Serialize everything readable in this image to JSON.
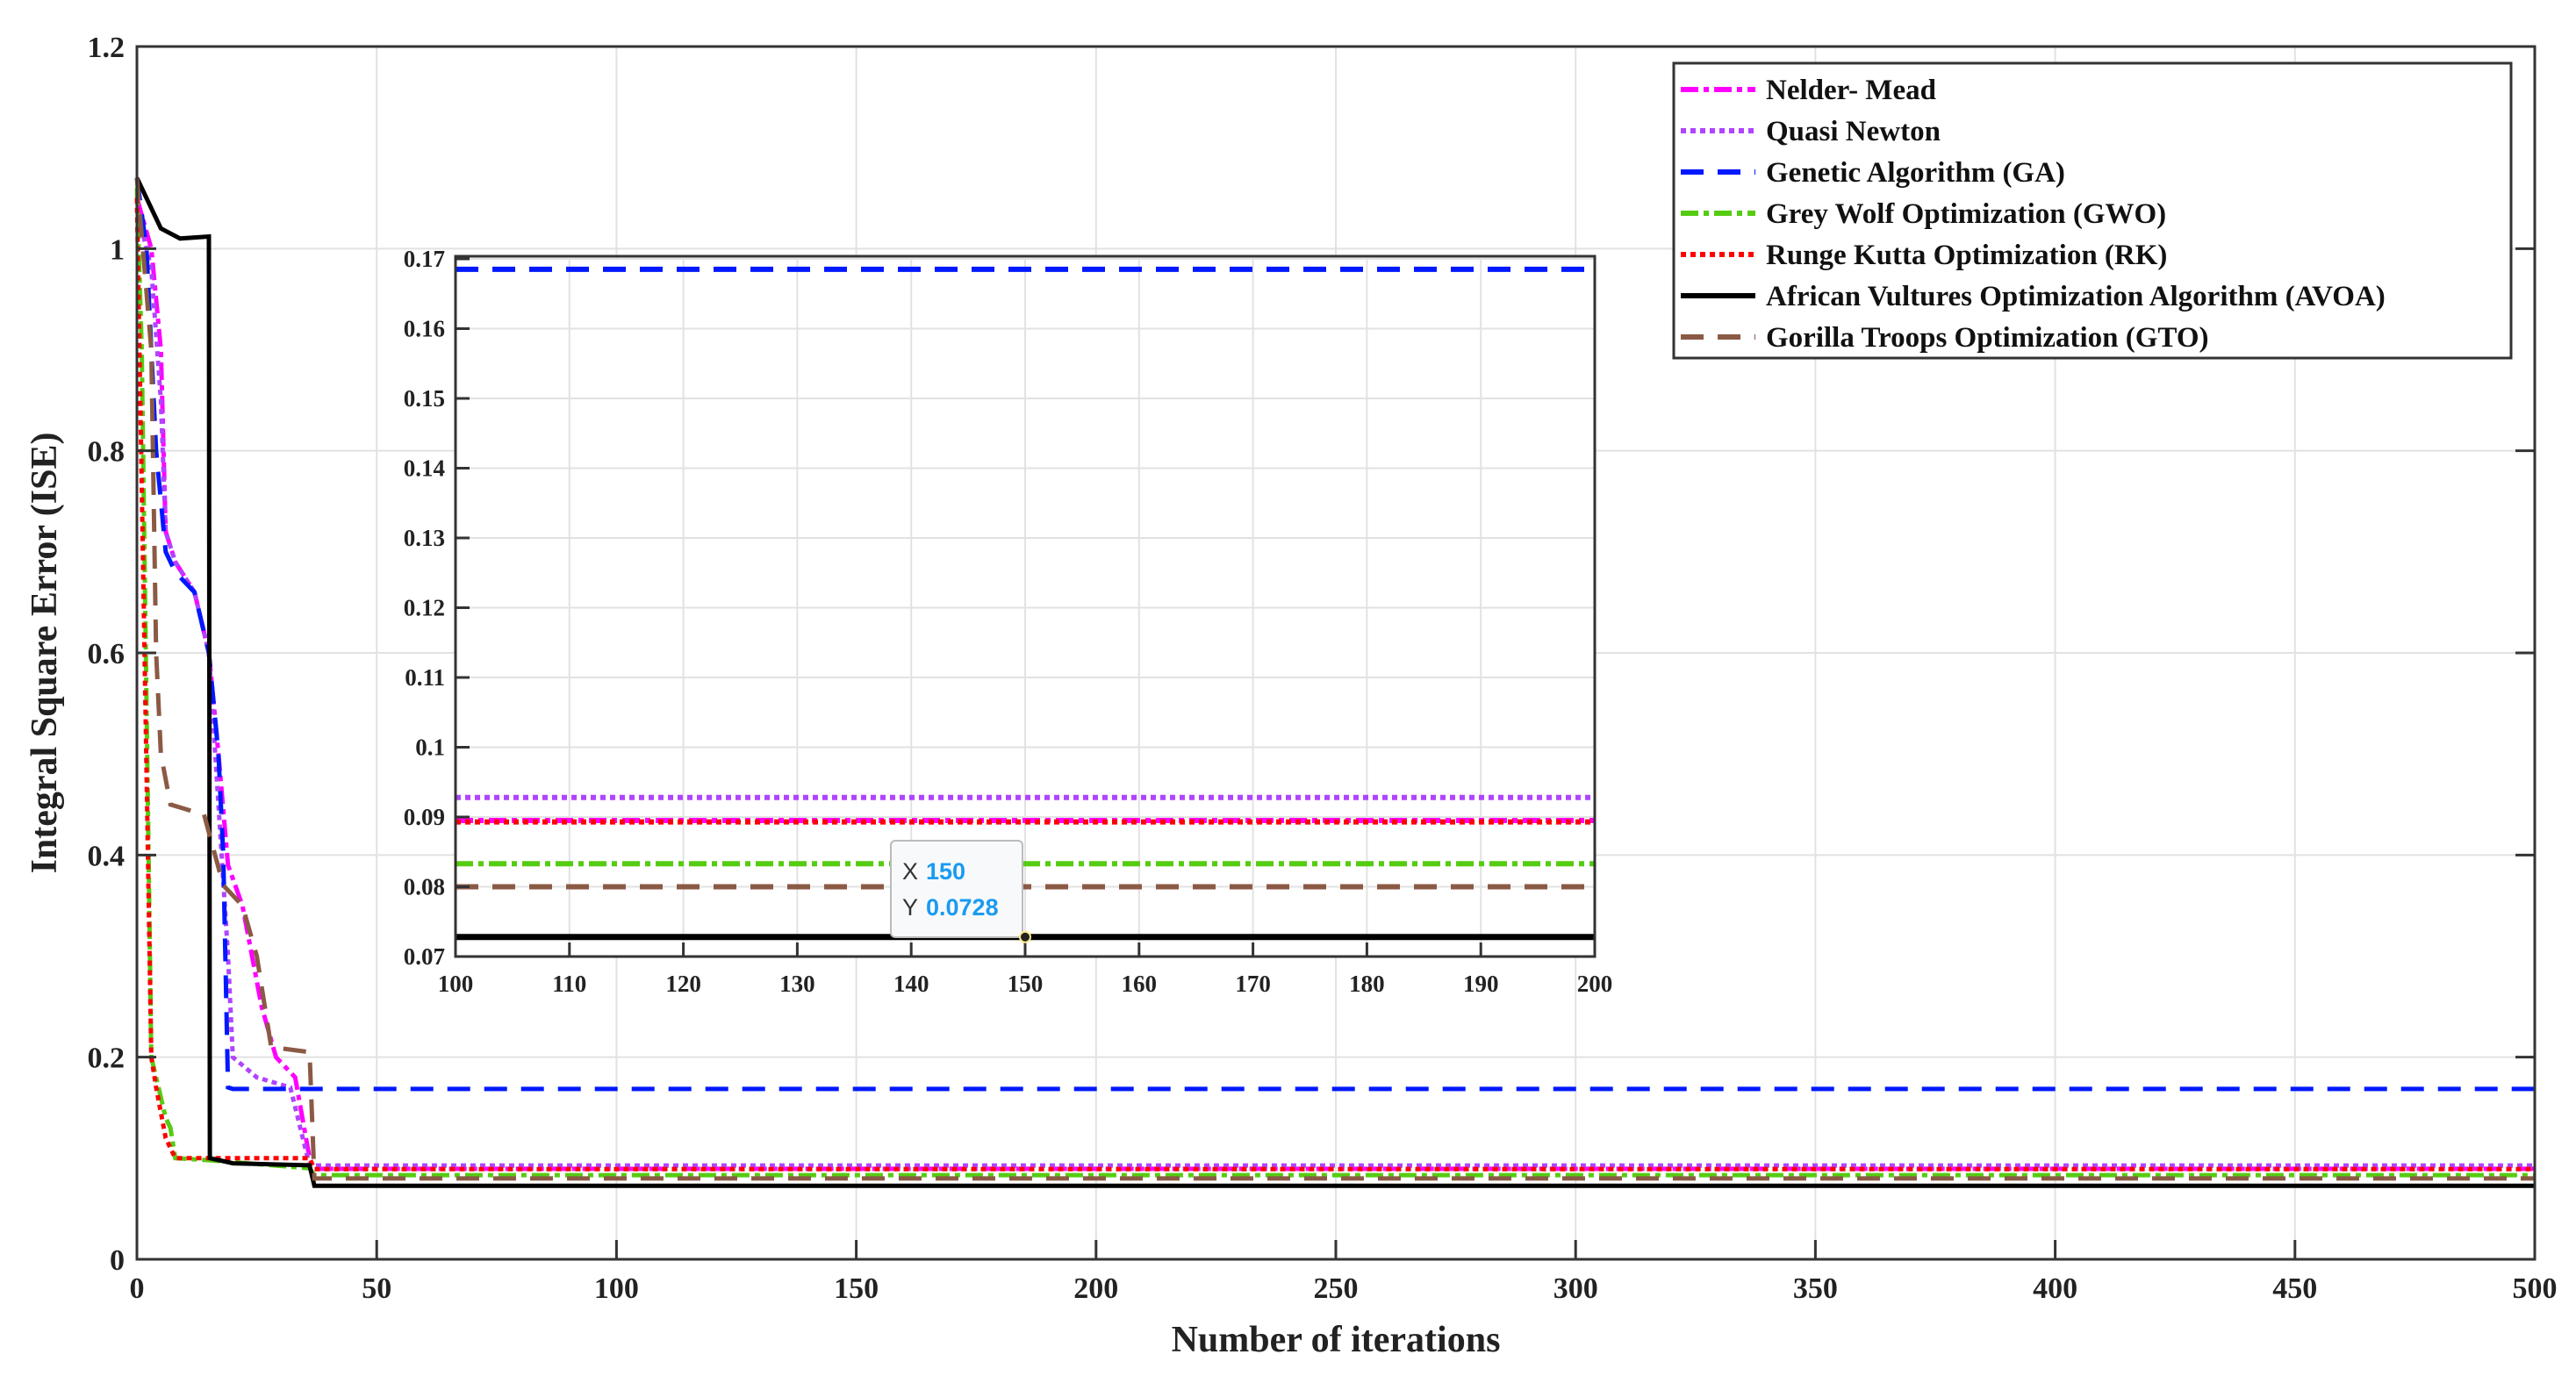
{
  "chart_data": {
    "type": "line",
    "title": "",
    "xlabel": "Number of iterations",
    "ylabel": "Integral Square Error (ISE)",
    "xlim": [
      0,
      500
    ],
    "ylim": [
      0,
      1.2
    ],
    "xticks": [
      0,
      50,
      100,
      150,
      200,
      250,
      300,
      350,
      400,
      450,
      500
    ],
    "yticks": [
      0,
      0.2,
      0.4,
      0.6,
      0.8,
      1,
      1.2
    ],
    "grid": true,
    "legend_position": "top-right",
    "series": [
      {
        "name": "Nelder- Mead",
        "color": "#ff00ff",
        "style": "dashdot",
        "points": [
          [
            0,
            1.05
          ],
          [
            3,
            1.0
          ],
          [
            5,
            0.9
          ],
          [
            6,
            0.72
          ],
          [
            8,
            0.69
          ],
          [
            12,
            0.66
          ],
          [
            15,
            0.6
          ],
          [
            17,
            0.5
          ],
          [
            19,
            0.39
          ],
          [
            22,
            0.35
          ],
          [
            26,
            0.25
          ],
          [
            29,
            0.2
          ],
          [
            33,
            0.18
          ],
          [
            36,
            0.1
          ],
          [
            37,
            0.0895
          ],
          [
            500,
            0.0895
          ]
        ]
      },
      {
        "name": "Quasi Newton",
        "color": "#b044ff",
        "style": "dotted",
        "points": [
          [
            0,
            1.04
          ],
          [
            3,
            0.98
          ],
          [
            5,
            0.85
          ],
          [
            6,
            0.72
          ],
          [
            8,
            0.69
          ],
          [
            12,
            0.66
          ],
          [
            15,
            0.6
          ],
          [
            17,
            0.45
          ],
          [
            19,
            0.3
          ],
          [
            20,
            0.2
          ],
          [
            25,
            0.18
          ],
          [
            32,
            0.17
          ],
          [
            36,
            0.0928
          ],
          [
            500,
            0.0928
          ]
        ]
      },
      {
        "name": "Genetic Algorithm (GA)",
        "color": "#0018ff",
        "style": "dashed",
        "points": [
          [
            0,
            1.07
          ],
          [
            2,
            1.0
          ],
          [
            4,
            0.8
          ],
          [
            6,
            0.7
          ],
          [
            8,
            0.68
          ],
          [
            12,
            0.66
          ],
          [
            15,
            0.6
          ],
          [
            17,
            0.5
          ],
          [
            18,
            0.4
          ],
          [
            19,
            0.17
          ],
          [
            20,
            0.1685
          ],
          [
            500,
            0.1685
          ]
        ]
      },
      {
        "name": "Grey Wolf Optimization (GWO)",
        "color": "#55cc11",
        "style": "dashdot",
        "points": [
          [
            0,
            1.06
          ],
          [
            1,
            0.9
          ],
          [
            3,
            0.2
          ],
          [
            4,
            0.18
          ],
          [
            6,
            0.14
          ],
          [
            7,
            0.13
          ],
          [
            8,
            0.1
          ],
          [
            15,
            0.098
          ],
          [
            36,
            0.09
          ],
          [
            37,
            0.0833
          ],
          [
            500,
            0.0833
          ]
        ]
      },
      {
        "name": "Runge Kutta Optimization (RK)",
        "color": "#ff0000",
        "style": "dotted",
        "points": [
          [
            0,
            1.05
          ],
          [
            3,
            0.2
          ],
          [
            4,
            0.17
          ],
          [
            6,
            0.12
          ],
          [
            8,
            0.1
          ],
          [
            36,
            0.1
          ],
          [
            37,
            0.0893
          ],
          [
            500,
            0.0893
          ]
        ]
      },
      {
        "name": "African Vultures Optimization Algorithm (AVOA)",
        "color": "#000000",
        "style": "solid",
        "points": [
          [
            0,
            1.07
          ],
          [
            2,
            1.05
          ],
          [
            5,
            1.02
          ],
          [
            9,
            1.01
          ],
          [
            15,
            1.012
          ],
          [
            15.2,
            0.1
          ],
          [
            20,
            0.095
          ],
          [
            36,
            0.093
          ],
          [
            37,
            0.0728
          ],
          [
            500,
            0.0728
          ]
        ]
      },
      {
        "name": "Gorilla Troops Optimization (GTO)",
        "color": "#8b5a45",
        "style": "dashed",
        "points": [
          [
            0,
            1.07
          ],
          [
            3,
            0.9
          ],
          [
            4,
            0.6
          ],
          [
            5,
            0.5
          ],
          [
            7,
            0.45
          ],
          [
            14,
            0.44
          ],
          [
            18,
            0.37
          ],
          [
            22,
            0.35
          ],
          [
            25,
            0.3
          ],
          [
            28,
            0.21
          ],
          [
            36,
            0.205
          ],
          [
            37,
            0.08
          ],
          [
            500,
            0.08
          ]
        ]
      }
    ],
    "inset": {
      "xlim": [
        100,
        200
      ],
      "ylim": [
        0.07,
        0.17
      ],
      "xticks": [
        100,
        110,
        120,
        130,
        140,
        150,
        160,
        170,
        180,
        190,
        200
      ],
      "yticks": [
        0.07,
        0.08,
        0.09,
        0.1,
        0.11,
        0.12,
        0.13,
        0.14,
        0.15,
        0.16,
        0.17
      ],
      "ytick_labels": [
        "0.07",
        "0.08",
        "0.09",
        "0.1",
        "0.11",
        "0.12",
        "0.13",
        "0.14",
        "0.15",
        "0.16",
        "0.17"
      ]
    },
    "datatip": {
      "x_key": "X",
      "x_value": "150",
      "y_key": "Y",
      "y_value": "0.0728",
      "x": 150,
      "y": 0.0728
    }
  }
}
